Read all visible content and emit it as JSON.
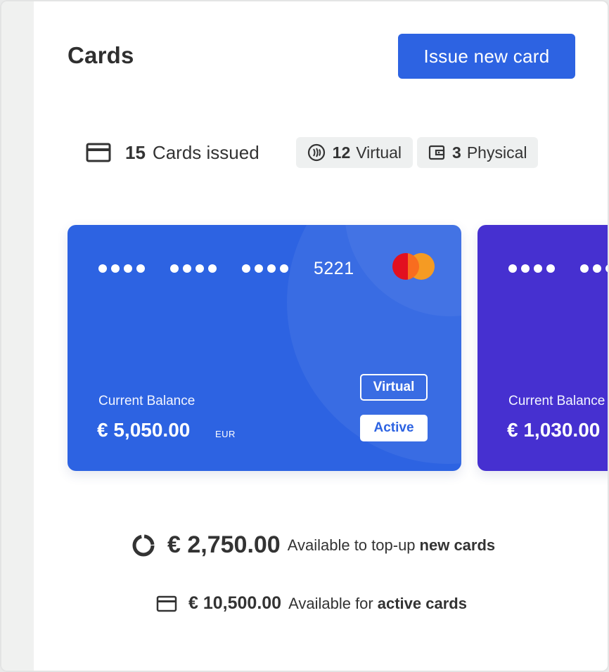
{
  "header": {
    "title": "Cards",
    "issue_button_label": "Issue new card"
  },
  "stats": {
    "issued_count": "15",
    "issued_label": "Cards issued",
    "virtual_count": "12",
    "virtual_label": "Virtual",
    "physical_count": "3",
    "physical_label": "Physical"
  },
  "cards": [
    {
      "masked_groups": [
        "••••",
        "••••",
        "••••"
      ],
      "last4": "5221",
      "brand": "mastercard",
      "balance_label": "Current Balance",
      "balance": "€ 5,050.00",
      "currency": "EUR",
      "type": "Virtual",
      "status": "Active",
      "color": "#2d63e2"
    },
    {
      "masked_groups": [
        "••••",
        "••••"
      ],
      "balance_label": "Current Balance",
      "balance": "€ 1,030.00",
      "color": "#4630d0"
    }
  ],
  "summary": {
    "topup_amount": "€ 2,750.00",
    "topup_text": "Available to top-up",
    "topup_strong": "new cards",
    "active_amount": "€ 10,500.00",
    "active_text": "Available for",
    "active_strong": "active cards"
  },
  "colors": {
    "primary": "#2d63e2",
    "secondary_card": "#4630d0",
    "mastercard_red": "#e2101f",
    "mastercard_orange": "#f59b23"
  },
  "icons": {
    "issued": "credit-card-icon",
    "virtual": "contactless-icon",
    "physical": "wallet-icon",
    "topup": "donut-chart-icon",
    "active": "credit-card-icon"
  }
}
